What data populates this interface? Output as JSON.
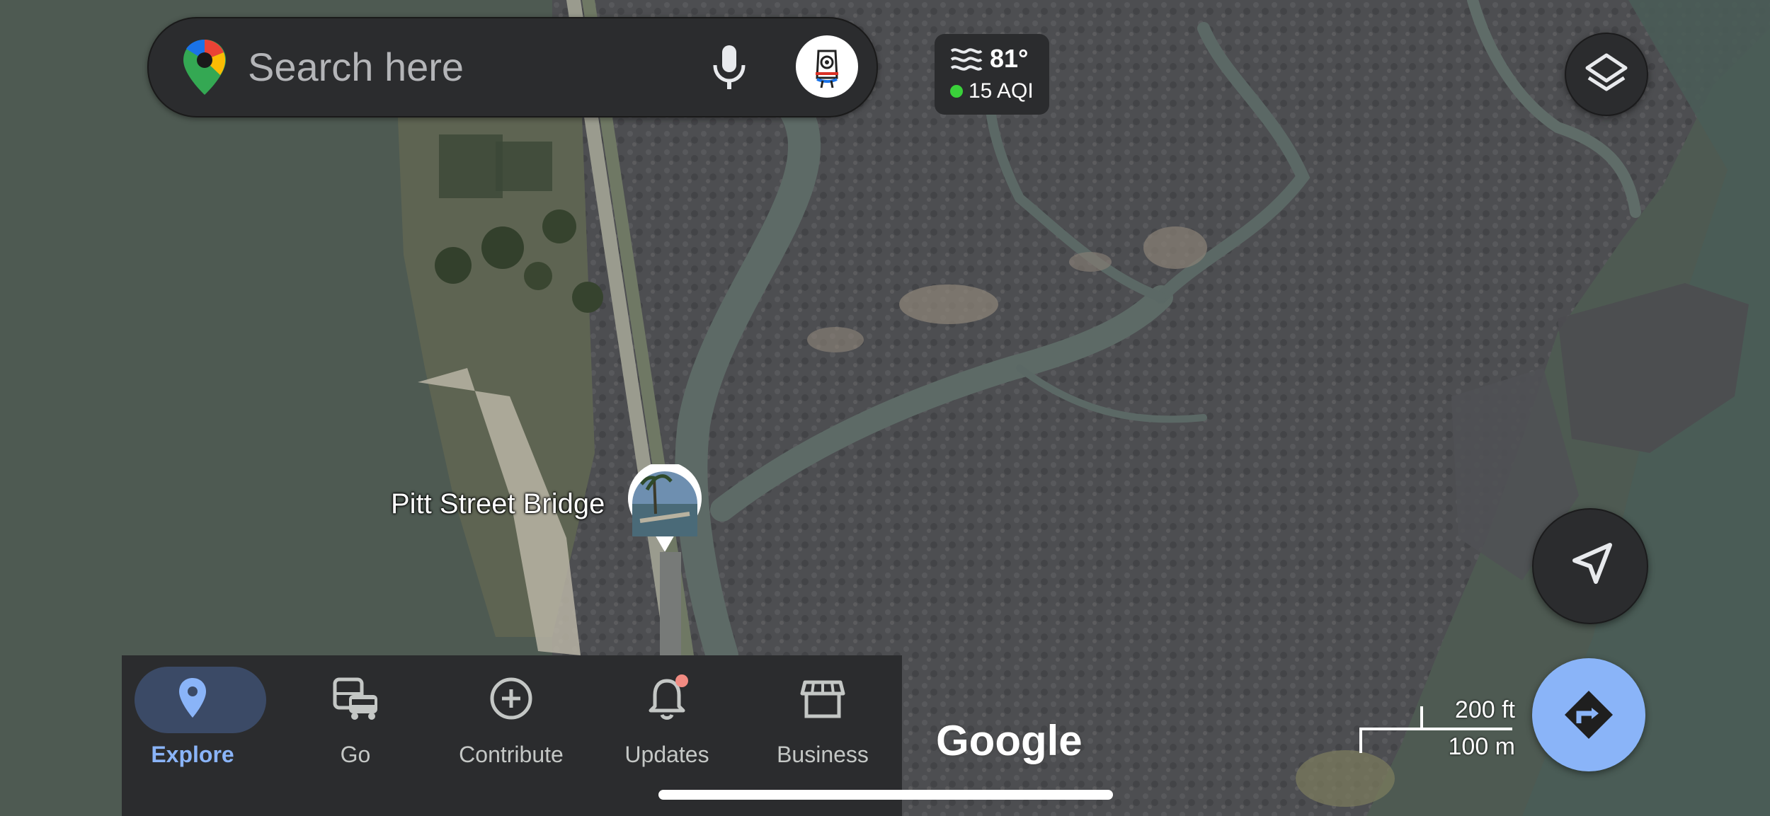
{
  "search": {
    "placeholder": "Search here"
  },
  "weather": {
    "temperature": "81°",
    "aqi": "15 AQI",
    "aqi_status_color": "#3ad13a"
  },
  "map": {
    "place_label": "Pitt Street Bridge",
    "scale_imperial": "200 ft",
    "scale_metric": "100 m",
    "attribution": "Google"
  },
  "bottom_nav": {
    "items": [
      {
        "label": "Explore",
        "icon": "explore-pin-icon",
        "active": true
      },
      {
        "label": "Go",
        "icon": "commute-icon",
        "active": false
      },
      {
        "label": "Contribute",
        "icon": "add-circle-icon",
        "active": false
      },
      {
        "label": "Updates",
        "icon": "bell-icon",
        "active": false
      },
      {
        "label": "Business",
        "icon": "storefront-icon",
        "active": false
      }
    ]
  },
  "colors": {
    "accent": "#8ab4f8",
    "surface": "#2b2c2e",
    "notification_dot": "#f28b82"
  }
}
